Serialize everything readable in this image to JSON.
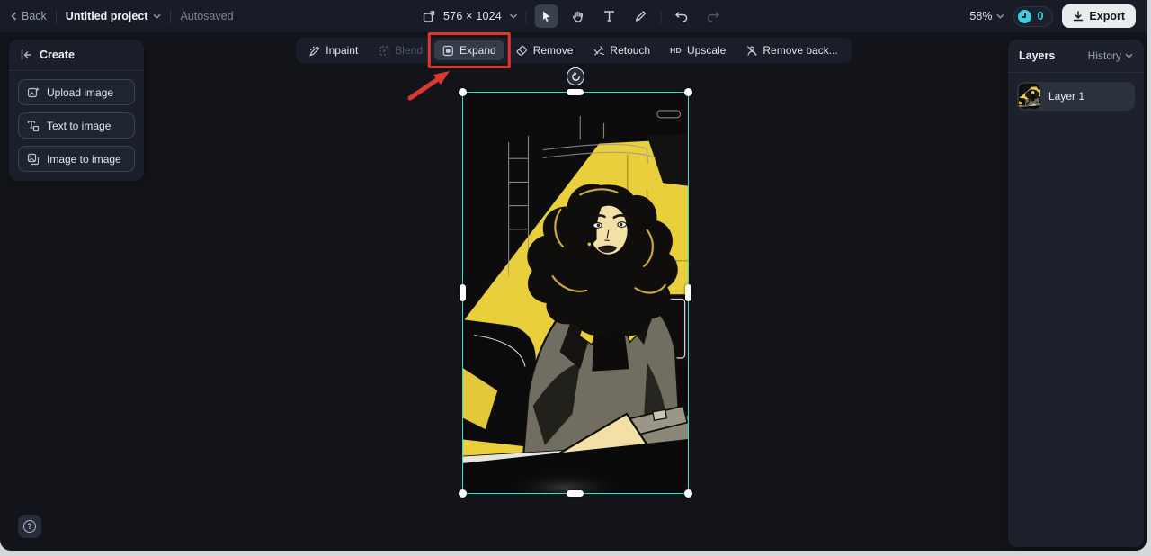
{
  "topbar": {
    "back_label": "Back",
    "project_title": "Untitled project",
    "autosaved_label": "Autosaved",
    "canvas_size": "576 × 1024",
    "zoom_level": "58%",
    "credits_count": "0",
    "export_label": "Export"
  },
  "actionbar": {
    "items": [
      {
        "label": "Inpaint",
        "state": "normal"
      },
      {
        "label": "Blend",
        "state": "disabled"
      },
      {
        "label": "Expand",
        "state": "active"
      },
      {
        "label": "Remove",
        "state": "normal"
      },
      {
        "label": "Retouch",
        "state": "normal"
      },
      {
        "label": "Upscale",
        "icon_text": "HD",
        "state": "normal"
      },
      {
        "label": "Remove back...",
        "state": "normal"
      }
    ]
  },
  "create_panel": {
    "title": "Create",
    "buttons": [
      {
        "label": "Upload image"
      },
      {
        "label": "Text to image"
      },
      {
        "label": "Image to image"
      }
    ]
  },
  "layers_panel": {
    "title": "Layers",
    "history_label": "History",
    "layers": [
      {
        "name": "Layer 1"
      }
    ]
  },
  "canvas": {
    "selection_color": "#35e0cb",
    "annotation_color": "#dd3732",
    "image_description": "black and yellow comic illustration of a woman in a gray blazer"
  },
  "colors": {
    "accent_teal": "#35e0cb",
    "annotation_red": "#dd3732",
    "credits_cyan": "#3bcfe2",
    "export_bg": "#e9ebee",
    "topbar_bg": "#171c26",
    "panel_bg": "#1a1f29",
    "canvas_bg": "#121419"
  }
}
